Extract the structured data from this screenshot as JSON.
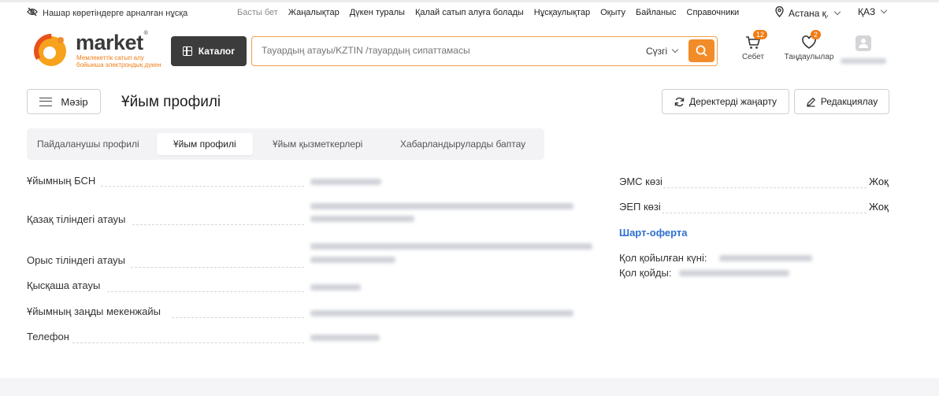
{
  "topbar": {
    "vision_label": "Нашар көретіндерге арналған нұсқа",
    "nav": [
      {
        "label": "Басты бет",
        "muted": true
      },
      {
        "label": "Жаңалықтар",
        "muted": false
      },
      {
        "label": "Дүкен туралы",
        "muted": false
      },
      {
        "label": "Қалай сатып алуға болады",
        "muted": false
      },
      {
        "label": "Нұсқаулықтар",
        "muted": false
      },
      {
        "label": "Оқыту",
        "muted": false
      },
      {
        "label": "Байланыс",
        "muted": false
      },
      {
        "label": "Справочники",
        "muted": false
      }
    ],
    "city": "Астана қ.",
    "language": "ҚАЗ"
  },
  "header": {
    "logo_name": "market",
    "logo_tagline_1": "Мемлекеттік сатып алу",
    "logo_tagline_2": "бойынша электрондық дүкен",
    "catalog_label": "Каталог",
    "search_placeholder": "Тауардың атауы/KZTIN /тауардың сипаттамасы",
    "filter_label": "Сүзгі",
    "cart_label": "Себет",
    "cart_count": "12",
    "favorites_label": "Таңдаулылар",
    "favorites_count": "2"
  },
  "page": {
    "menu_label": "Мәзір",
    "title": "Ұйым профилі",
    "refresh_label": "Деректерді жаңарту",
    "edit_label": "Редакциялау"
  },
  "tabs": [
    {
      "label": "Пайдаланушы профилі",
      "active": false
    },
    {
      "label": "Ұйым профилі",
      "active": true
    },
    {
      "label": "Ұйым қызметкерлері",
      "active": false
    },
    {
      "label": "Хабарландыруларды баптау",
      "active": false
    }
  ],
  "fields": [
    {
      "label": "Ұйымның БСН"
    },
    {
      "label": "Қазақ тіліндегі атауы"
    },
    {
      "label": "Орыс тіліндегі атауы"
    },
    {
      "label": "Қысқаша атауы"
    },
    {
      "label": "Ұйымның заңды мекенжайы"
    },
    {
      "label": "Телефон"
    }
  ],
  "right_fields": [
    {
      "label": "ЭМС көзі",
      "value": "Жоқ"
    },
    {
      "label": "ЭЕП көзі",
      "value": "Жоқ"
    }
  ],
  "offer_link": "Шарт-оферта",
  "signature": {
    "signed_date_label": "Қол қойылған күні:",
    "signed_by_label": "Қол қойды:"
  },
  "colors": {
    "accent": "#f28c28",
    "link": "#2f6fd1",
    "dark_button": "#3c3c3c"
  }
}
